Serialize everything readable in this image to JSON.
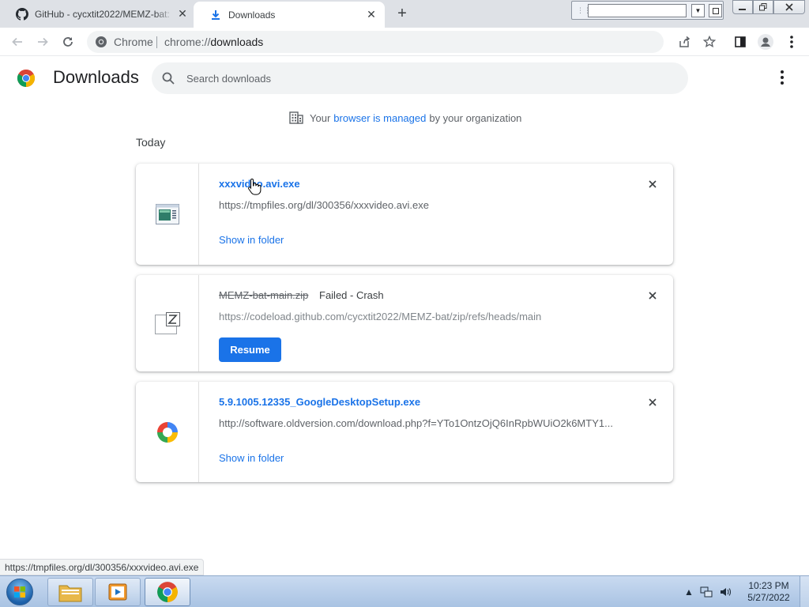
{
  "tabs": [
    {
      "title": "GitHub - cycxtit2022/MEMZ-bat: ",
      "icon": "github-icon",
      "close": "✕"
    },
    {
      "title": "Downloads",
      "icon": "download-icon",
      "close": "✕"
    }
  ],
  "new_tab": "+",
  "toolbar": {
    "site_chip": "Chrome",
    "url_scheme": "chrome://",
    "url_path": "downloads"
  },
  "page": {
    "title": "Downloads",
    "search_placeholder": "Search downloads",
    "managed_prefix": "Your",
    "managed_link": "browser is managed",
    "managed_suffix": "by your organization",
    "section": "Today"
  },
  "downloads": [
    {
      "name": "xxxvideo.avi.exe",
      "url": "https://tmpfiles.org/dl/300356/xxxvideo.avi.exe",
      "action": "Show in folder",
      "status": "",
      "icon": "executable-file-icon"
    },
    {
      "name": "MEMZ-bat-main.zip",
      "url": "https://codeload.github.com/cycxtit2022/MEMZ-bat/zip/refs/heads/main",
      "action": "Resume",
      "status": "Failed - Crash",
      "icon": "zip-file-icon"
    },
    {
      "name": "5.9.1005.12335_GoogleDesktopSetup.exe",
      "url": "http://software.oldversion.com/download.php?f=YTo1OntzOjQ6InRpbWUiO2k6MTY1...",
      "action": "Show in folder",
      "status": "",
      "icon": "google-desktop-icon"
    }
  ],
  "status_bubble": "https://tmpfiles.org/dl/300356/xxxvideo.avi.exe",
  "taskbar": {
    "time": "10:23 PM",
    "date": "5/27/2022"
  },
  "colors": {
    "accent": "#1a73e8",
    "tabstrip": "#dee1e6"
  }
}
